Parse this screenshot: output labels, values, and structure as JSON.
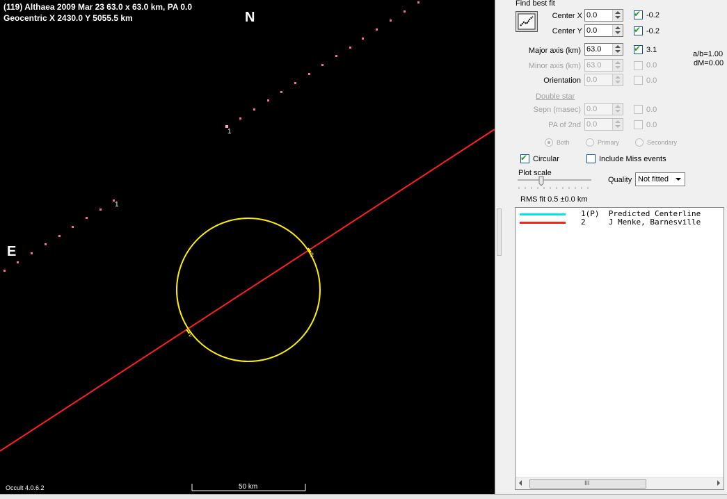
{
  "plot": {
    "title_line1": "(119) Althaea  2009 Mar 23   63.0 x 63.0 km,  PA 0.0",
    "title_line2": "Geocentric  X  2430.0  Y 5055.5 km",
    "north_label": "N",
    "east_label": "E",
    "version": "Occult 4.0.6.2",
    "scale_label": "50 km",
    "chord_labels": [
      "1",
      "1",
      "2",
      "2"
    ],
    "colors": {
      "background": "#000000",
      "ellipse": "#ffee00",
      "chord": "#ff1f1f",
      "track_dots": "#ff6b8a",
      "text": "#ffffff"
    }
  },
  "panel": {
    "find_best_fit": "Find best fit",
    "center_x": {
      "label": "Center X",
      "value": "0.0",
      "fit_checked": true,
      "fit_value": "-0.2"
    },
    "center_y": {
      "label": "Center Y",
      "value": "0.0",
      "fit_checked": true,
      "fit_value": "-0.2"
    },
    "major_axis": {
      "label": "Major axis (km)",
      "value": "63.0",
      "fit_checked": true,
      "fit_value": "3.1"
    },
    "minor_axis": {
      "label": "Minor axis (km)",
      "value": "63.0",
      "fit_checked": false,
      "fit_value": "0.0"
    },
    "orientation": {
      "label": "Orientation",
      "value": "0.0",
      "fit_checked": false,
      "fit_value": "0.0"
    },
    "ratio_text": "a/b=1.00",
    "dm_text": "dM=0.00",
    "double_star": "Double star",
    "sepn": {
      "label": "Sepn (masec)",
      "value": "0.0",
      "fit_checked": false,
      "fit_value": "0.0"
    },
    "pa_2nd": {
      "label": "PA of 2nd",
      "value": "0.0",
      "fit_checked": false,
      "fit_value": "0.0"
    },
    "radio_both": "Both",
    "radio_primary": "Primary",
    "radio_secondary": "Secondary",
    "circular": {
      "label": "Circular",
      "checked": true
    },
    "include_miss": {
      "label": "Include Miss events",
      "checked": false
    },
    "plot_scale_label": "Plot scale",
    "quality_label": "Quality",
    "quality_value": "Not fitted",
    "rms_text": "RMS fit 0.5 ±0.0 km",
    "legend": [
      {
        "text": "1(P)  Predicted Centerline",
        "color": "#00e5ee"
      },
      {
        "text": "2     J Menke, Barnesville",
        "color": "#ff1f1f"
      }
    ],
    "scrollbar_grip": "III"
  }
}
